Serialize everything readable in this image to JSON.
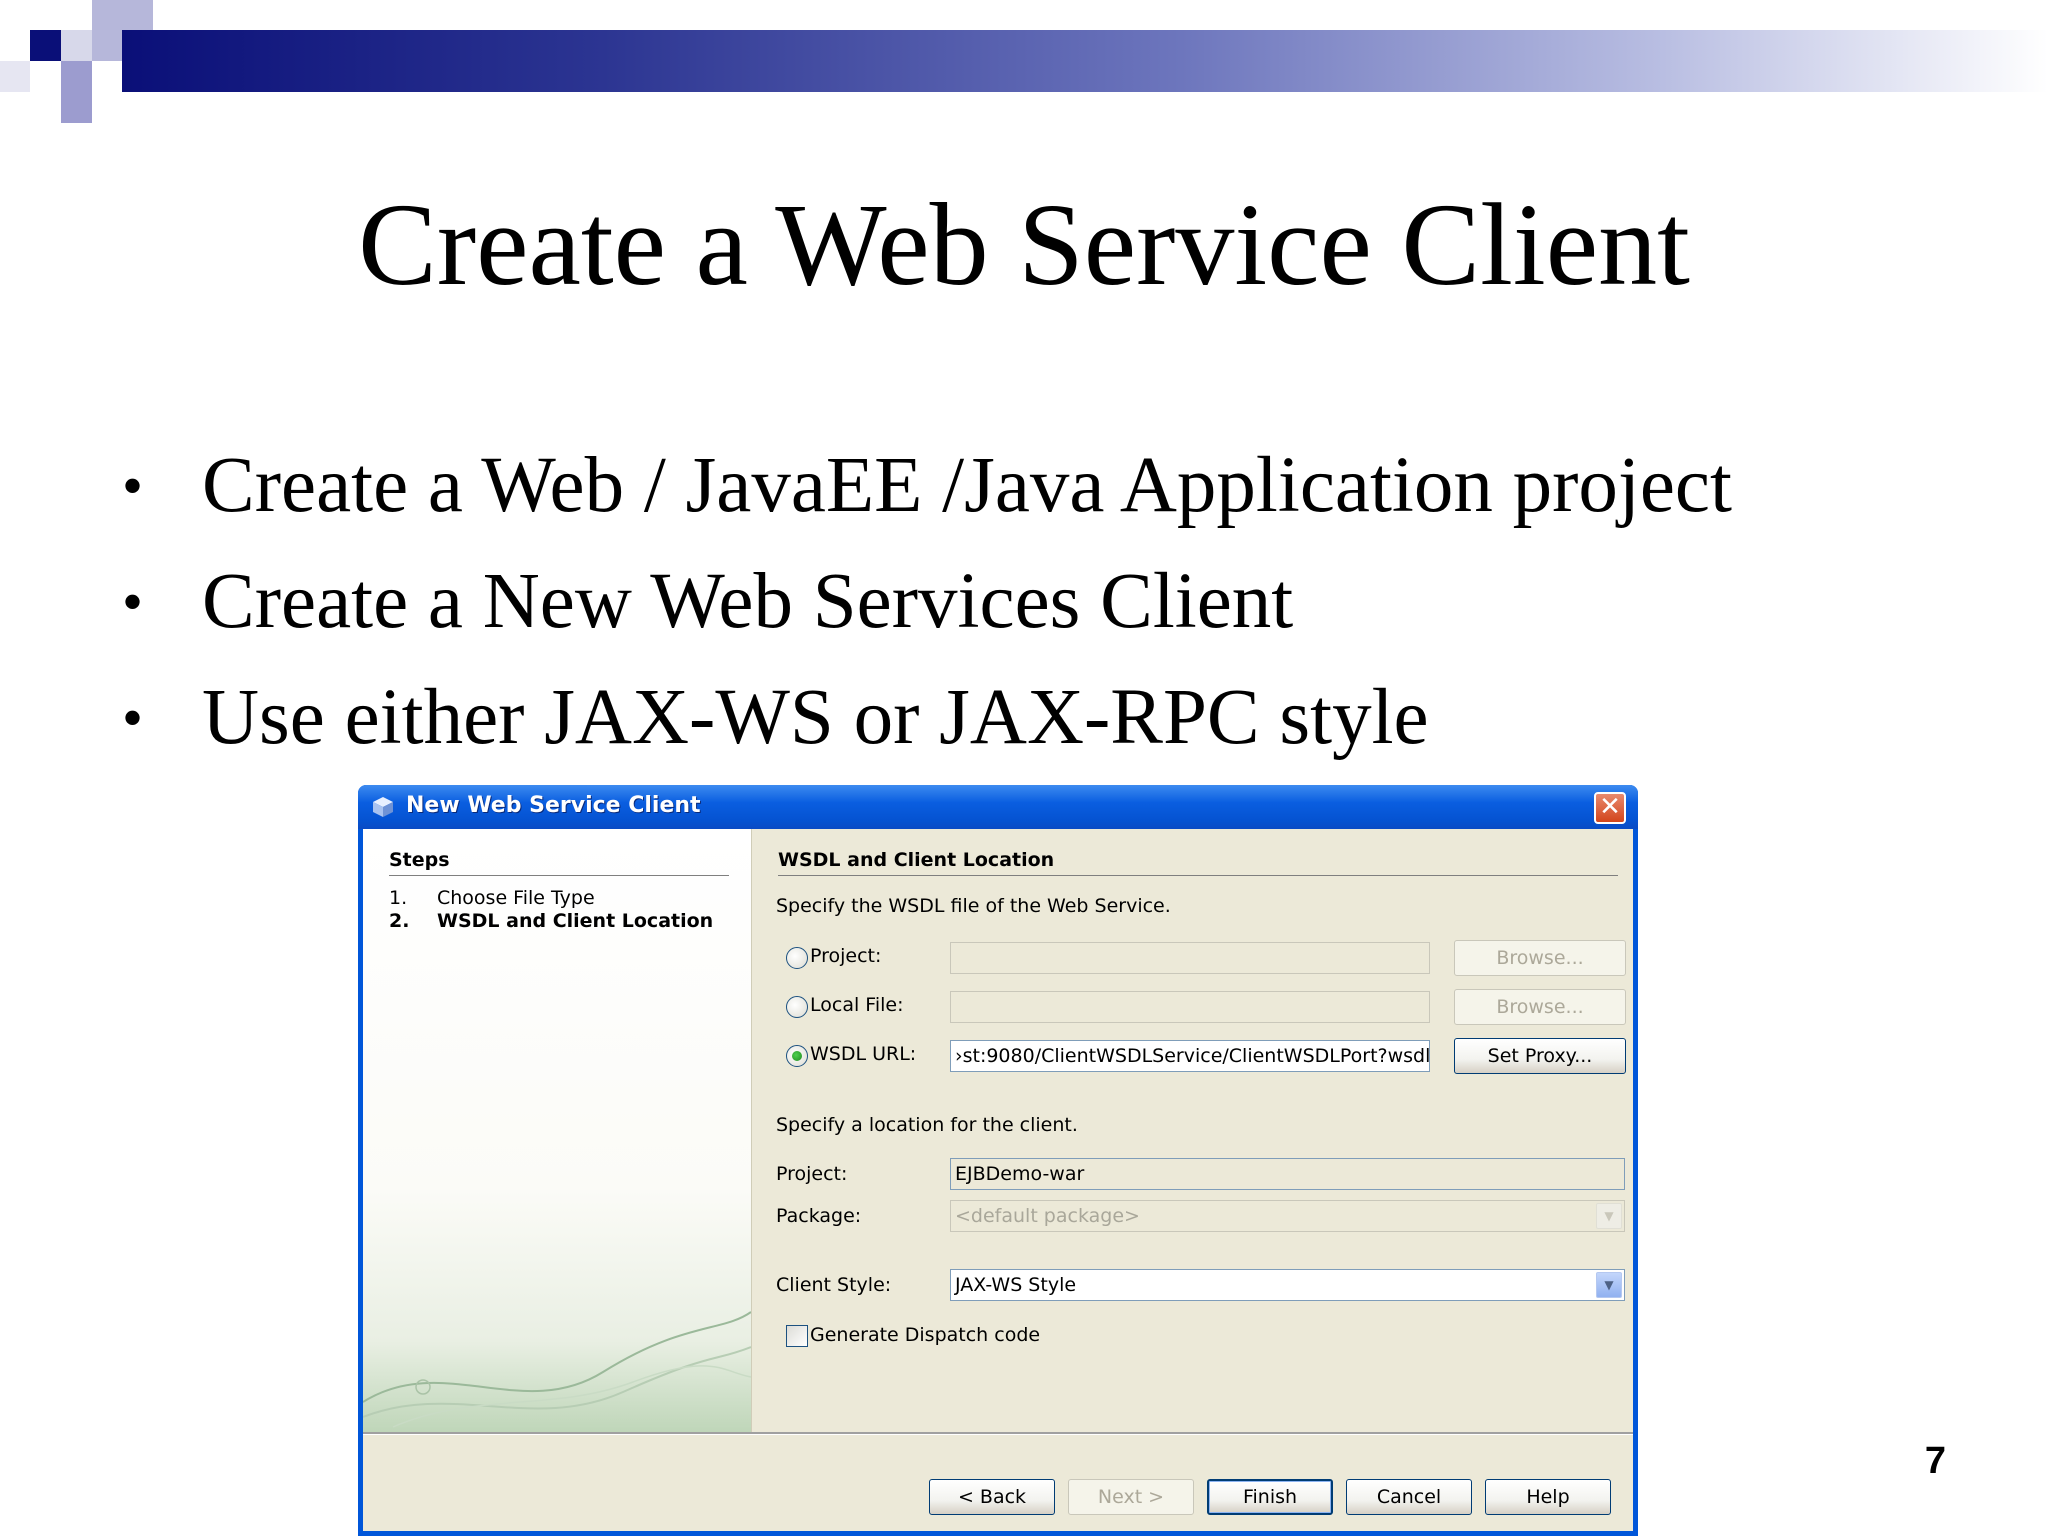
{
  "slide": {
    "title": "Create a Web Service Client",
    "bullets": [
      "Create a Web / JavaEE /Java Application project",
      "Create a New Web Services Client",
      "Use either JAX-WS or JAX-RPC style"
    ],
    "bullet_symbol": "•",
    "page_number": "7",
    "header_color": "#0a0f78"
  },
  "dialog": {
    "title": "New Web Service Client",
    "close_glyph": "✕",
    "steps": {
      "heading": "Steps",
      "items": [
        {
          "num": "1.",
          "label": "Choose File Type"
        },
        {
          "num": "2.",
          "label": "WSDL and Client Location"
        }
      ]
    },
    "section_title": "WSDL and Client Location",
    "wsdl_prompt": "Specify the WSDL file of the Web Service.",
    "sources": [
      {
        "label": "Project:",
        "value": "",
        "button": "Browse...",
        "selected": false
      },
      {
        "label": "Local File:",
        "value": "",
        "button": "Browse...",
        "selected": false
      },
      {
        "label": "WSDL URL:",
        "value": "›st:9080/ClientWSDLService/ClientWSDLPort?wsdl",
        "button": "Set Proxy...",
        "selected": true
      }
    ],
    "location_prompt": "Specify a location for the client.",
    "project": {
      "label": "Project:",
      "value": "EJBDemo-war"
    },
    "package": {
      "label": "Package:",
      "value": "<default package>"
    },
    "client_style": {
      "label": "Client Style:",
      "value": "JAX-WS Style"
    },
    "dispatch": {
      "label": "Generate Dispatch code",
      "checked": false
    },
    "buttons": {
      "back": "< Back",
      "next": "Next >",
      "finish": "Finish",
      "cancel": "Cancel",
      "help": "Help"
    },
    "colors": {
      "titlebar": "#0553d2",
      "face": "#ece9d8"
    },
    "icons": {
      "titlebar": "netbeans-cube-icon",
      "close": "close-icon",
      "dropdown": "chevron-down-icon"
    }
  }
}
